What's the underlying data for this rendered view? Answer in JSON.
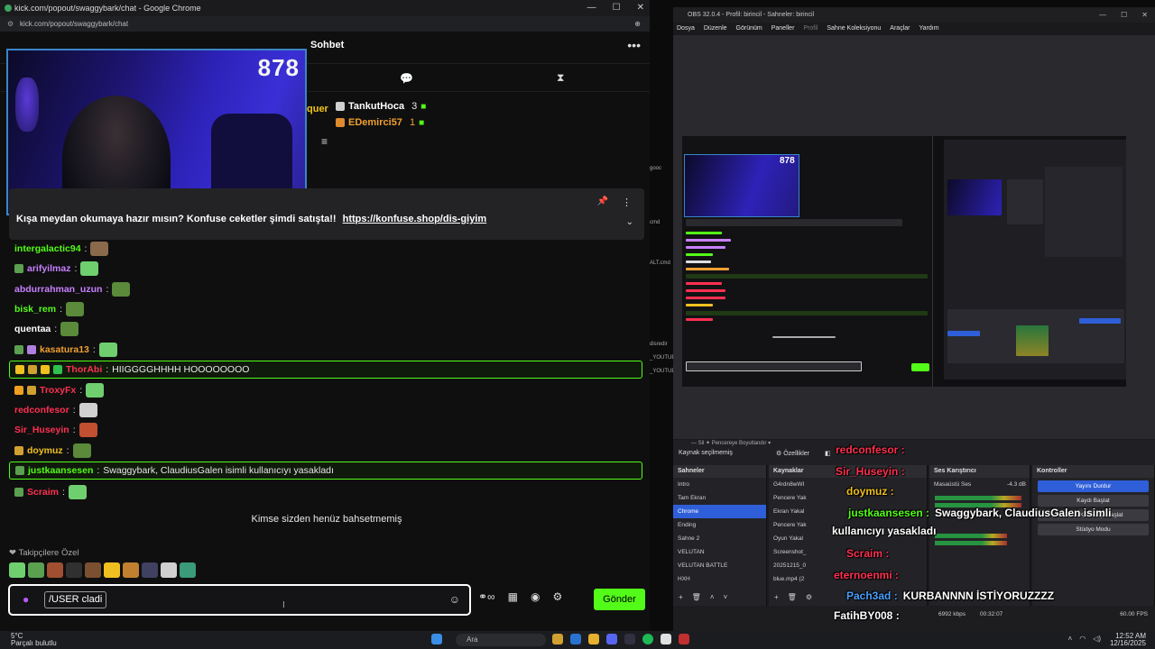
{
  "chrome": {
    "title": "kick.com/popout/swaggybark/chat - Google Chrome",
    "url": "kick.com/popout/swaggybark/chat",
    "window_controls": [
      "—",
      "☐",
      "✕"
    ]
  },
  "chat": {
    "title": "Sohbet",
    "viewer_count": "878",
    "partial_name": "quer",
    "leaders": [
      {
        "name": "TankutHoca",
        "count": "3",
        "color": "#ffffff",
        "badge_color": "#d0d0d0"
      },
      {
        "name": "EDemirci57",
        "count": "1",
        "color": "#f0a030",
        "badge_color": "#e08a30"
      }
    ],
    "pinned": {
      "text": "Kışa meydan okumaya hazır mısın? Konfuse ceketler şimdi satışta!!",
      "link": "https://konfuse.shop/dis-giyim"
    },
    "messages": [
      {
        "user": "intergalactic94",
        "text": "",
        "color": "#53fc18",
        "badges": [],
        "emote": "#8a6a4a",
        "highlight": false
      },
      {
        "user": "arifyilmaz",
        "text": "",
        "color": "#c880ff",
        "badges": [
          "#5aa050"
        ],
        "emote": "#6fcf6f",
        "highlight": false
      },
      {
        "user": "abdurrahman_uzun",
        "text": "",
        "color": "#c880ff",
        "badges": [],
        "emote": "#5a8a3a",
        "highlight": false
      },
      {
        "user": "bisk_rem",
        "text": "",
        "color": "#53fc18",
        "badges": [],
        "emote": "#5a8a3a",
        "highlight": false
      },
      {
        "user": "quentaa",
        "text": "",
        "color": "#ffffff",
        "badges": [],
        "emote": "#5a8a3a",
        "highlight": false
      },
      {
        "user": "kasatura13",
        "text": "",
        "color": "#f0a030",
        "badges": [
          "#5aa050",
          "#b080e0"
        ],
        "emote": "#6fcf6f",
        "highlight": false
      },
      {
        "user": "ThorAbi",
        "text": "HIIGGGGHHHH HOOOOOOOO",
        "color": "#ff3050",
        "badges": [
          "#f0c020",
          "#d0a030",
          "#f0c020",
          "#30c050"
        ],
        "emote": "",
        "highlight": true
      },
      {
        "user": "TroxyFx",
        "text": "",
        "color": "#ff3050",
        "badges": [
          "#f0a020",
          "#d0a030"
        ],
        "emote": "#6fcf6f",
        "highlight": false
      },
      {
        "user": "redconfesor",
        "text": "",
        "color": "#ff3050",
        "badges": [],
        "emote": "#d0d0d0",
        "highlight": false
      },
      {
        "user": "Sir_Huseyin",
        "text": "",
        "color": "#ff3050",
        "badges": [],
        "emote": "#c05030",
        "highlight": false
      },
      {
        "user": "doymuz",
        "text": "",
        "color": "#f0c020",
        "badges": [
          "#d0a030"
        ],
        "emote": "#5a8a3a",
        "highlight": false
      },
      {
        "user": "justkaansesen",
        "text": "Swaggybark, ClaudiusGalen isimli kullanıcıyı yasakladı",
        "color": "#53fc18",
        "badges": [
          "#5aa050"
        ],
        "emote": "",
        "highlight": true
      },
      {
        "user": "Scraim",
        "text": "",
        "color": "#ff3050",
        "badges": [
          "#5aa050"
        ],
        "emote": "#6fcf6f",
        "highlight": false
      }
    ],
    "no_mentions": "Kimse sizden henüz bahsetmemiş",
    "followers_label": "Takipçilere Özel",
    "emote_strip": [
      "#6fcf6f",
      "#5aa050",
      "#a05030",
      "#303030",
      "#7a5030",
      "#f0c020",
      "#c08030",
      "#404060",
      "#d0d0d0",
      "#3a9a7a"
    ],
    "input_value": "/USER cladi",
    "send_label": "Gönder"
  },
  "taskbar": {
    "weather_temp": "5°C",
    "weather_text": "Parçalı bulutlu",
    "search_placeholder": "Ara",
    "time": "12:52 AM",
    "date": "12/16/2025"
  },
  "obs": {
    "title": "OBS 32.0.4 - Profil: birincil - Sahneler: birincil",
    "menu": [
      "Dosya",
      "Düzenle",
      "Görünüm",
      "Paneller",
      "Profil",
      "Sahne Koleksiyonu",
      "Araçlar",
      "Yardım"
    ],
    "no_source": "Kaynak seçilmemiş",
    "properties": "Özellikler",
    "scenes_title": "Sahneler",
    "scenes": [
      "Intro",
      "Tam Ekran",
      "Chrome",
      "Ending",
      "Sahne 2",
      "VELUTAN",
      "VELUTAN BATTLE",
      "HXH"
    ],
    "selected_scene": "Chrome",
    "sources_title": "Kaynaklar",
    "sources": [
      "G4rdn8wWI",
      "Pencere Yak",
      "Ekran Yakal",
      "Pencere Yak",
      "Oyun Yakal",
      "Screenshot_",
      "20251215_0",
      "blue.mp4 (2"
    ],
    "mixer_title": "Ses Karıştırıcı",
    "mixer_label": "Masaüstü Ses",
    "mixer_db": "-4.3 dB",
    "controls_title": "Kontroller",
    "controls": [
      "Yayını Durdur",
      "Kaydı Başlat",
      "Sanal Kamerayı Başlat",
      "Stüdyo Modu"
    ],
    "kbps": "6992 kbps",
    "time": "00:32:07",
    "fps": "60.00 FPS",
    "mini_count": "878"
  },
  "overlay": [
    {
      "name": "redconfesor :",
      "text": "",
      "color": "#ff3050"
    },
    {
      "name": "Sir_Huseyin :",
      "text": "",
      "color": "#ff3050"
    },
    {
      "name": "doymuz :",
      "text": "",
      "color": "#f0c020"
    },
    {
      "name": "justkaansesen :",
      "text": "Swaggybark, ClaudiusGalen isimli",
      "color": "#53fc18"
    },
    {
      "name": "",
      "text": "kullanıcıyı yasakladı",
      "color": "#ffffff"
    },
    {
      "name": "Scraim :",
      "text": "",
      "color": "#ff3050"
    },
    {
      "name": "eternoenmi :",
      "text": "",
      "color": "#ff3050"
    },
    {
      "name": "Pach3ad :",
      "text": "KURBANNNN İSTİYORUZZZZ",
      "color": "#4aa0ff"
    },
    {
      "name": "FatihBY008 :",
      "text": "",
      "color": "#ffffff"
    }
  ],
  "behind_window": [
    "gooc",
    "",
    "",
    "",
    "cmd",
    "",
    "",
    "ALT.cmd",
    "",
    "",
    "",
    "",
    "",
    "disredir",
    "_YOUTUE",
    "_YOUTUE"
  ]
}
